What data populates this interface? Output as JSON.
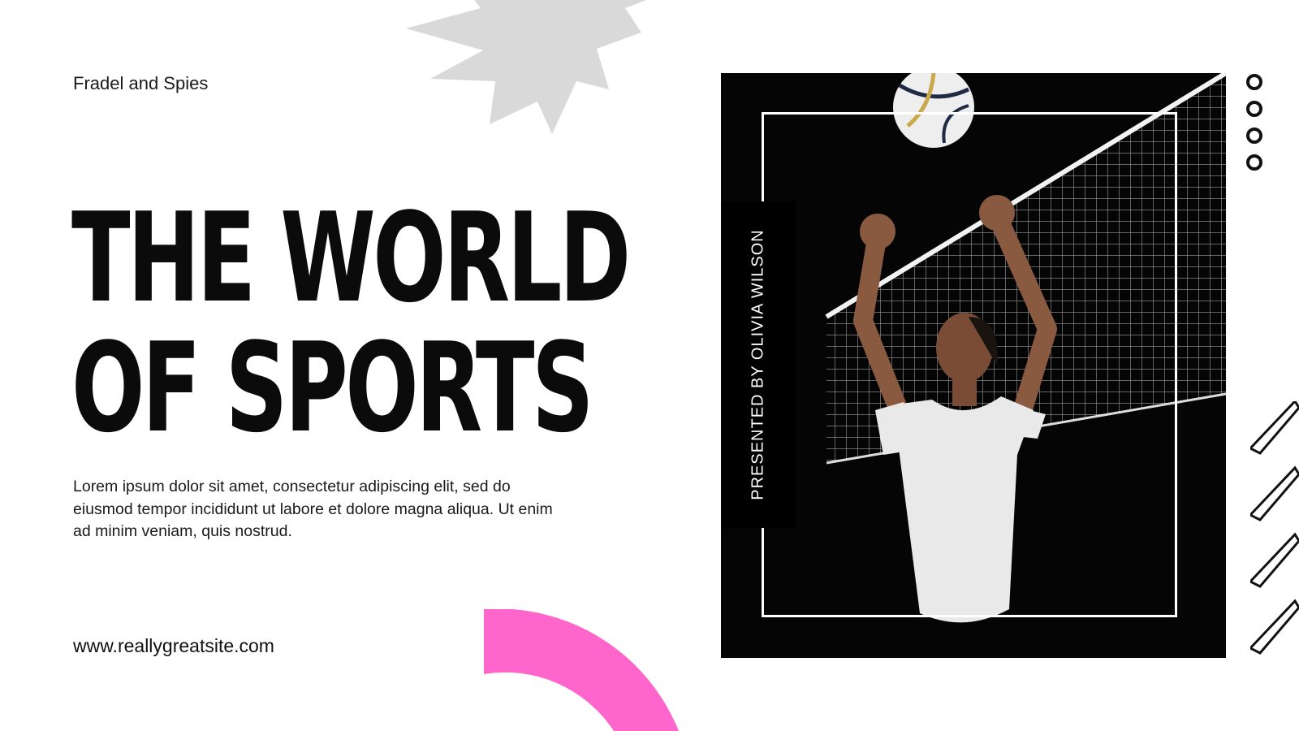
{
  "brand": "Fradel and Spies",
  "title": {
    "line1": "THE WORLD",
    "line2": "OF SPORTS"
  },
  "description": "Lorem ipsum dolor sit amet, consectetur adipiscing elit, sed do eiusmod tempor incididunt ut labore et dolore magna aliqua. Ut enim ad minim veniam, quis nostrud.",
  "website": "www.reallygreatsite.com",
  "presenter": "PRESENTED BY OLIVIA WILSON",
  "photo": {
    "subject": "volleyball-player"
  },
  "colors": {
    "accent_pink": "#ff66cc",
    "burst_gray": "#d9d9d9",
    "ink": "#0b0b0b",
    "photo_bg": "#050505"
  },
  "icons": [
    "starburst-shape",
    "arc-shape",
    "circle-dots-icon",
    "slash-lines-icon"
  ]
}
